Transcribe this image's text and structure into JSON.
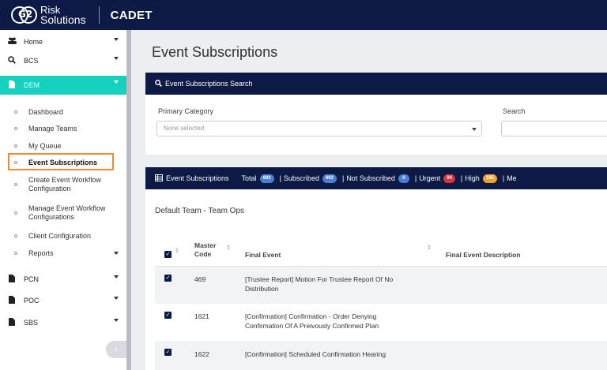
{
  "header": {
    "logo_line1": "Risk",
    "logo_line2": "Solutions",
    "logo_mark": "G2",
    "app_name": "CADET"
  },
  "sidebar": {
    "items": [
      {
        "label": "Home",
        "icon": "users-icon"
      },
      {
        "label": "BCS",
        "icon": "search-icon"
      },
      {
        "label": "DEM",
        "icon": "file-icon"
      }
    ],
    "sub_items": [
      "Dashboard",
      "Manage Teams",
      "My Queue",
      "Event Subscriptions",
      "Create Event Workflow Configuration",
      "Manage Event Workflow Configurations",
      "Client Configuration",
      "Reports"
    ],
    "bottom_items": [
      {
        "label": "PCN",
        "icon": "file-icon"
      },
      {
        "label": "POC",
        "icon": "file-icon"
      },
      {
        "label": "SBS",
        "icon": "file-icon"
      }
    ],
    "collapse_glyph": "‹"
  },
  "page": {
    "title": "Event Subscriptions"
  },
  "search_panel": {
    "title": "Event Subscriptions Search",
    "primary_category_label": "Primary Category",
    "primary_category_value": "None selected",
    "search_label": "Search"
  },
  "list_panel": {
    "title": "Event Subscriptions",
    "stats": {
      "total_label": "Total",
      "total": "692",
      "subscribed_label": "Subscribed",
      "subscribed": "692",
      "not_subscribed_label": "Not Subscribed",
      "not_subscribed": "0",
      "urgent_label": "Urgent",
      "urgent": "94",
      "high_label": "High",
      "high": "165",
      "medium_label": "Me"
    },
    "team": "Default Team - Team Ops",
    "columns": {
      "master_code_1": "Master",
      "master_code_2": "Code",
      "final_event": "Final Event",
      "final_event_description": "Final Event Description"
    },
    "rows": [
      {
        "code": "469",
        "event_1": "[Trustee Report] Motion For Trustee Report Of No",
        "event_2": "Distribution",
        "description": ""
      },
      {
        "code": "1621",
        "event_1": "[Confirmation] Confirmation - Order Denying",
        "event_2": "Confirmation Of A Preivously Confirmed Plan",
        "description": ""
      },
      {
        "code": "1622",
        "event_1": "[Confirmation] Scheduled Confirmation Hearing",
        "event_2": "",
        "description": ""
      }
    ]
  },
  "colors": {
    "navy": "#0c1a45",
    "teal": "#17d1c0",
    "highlight": "#f08a2e",
    "pill_blue": "#4a7fd6",
    "pill_red": "#d9343b",
    "pill_orange": "#f5a02a"
  }
}
